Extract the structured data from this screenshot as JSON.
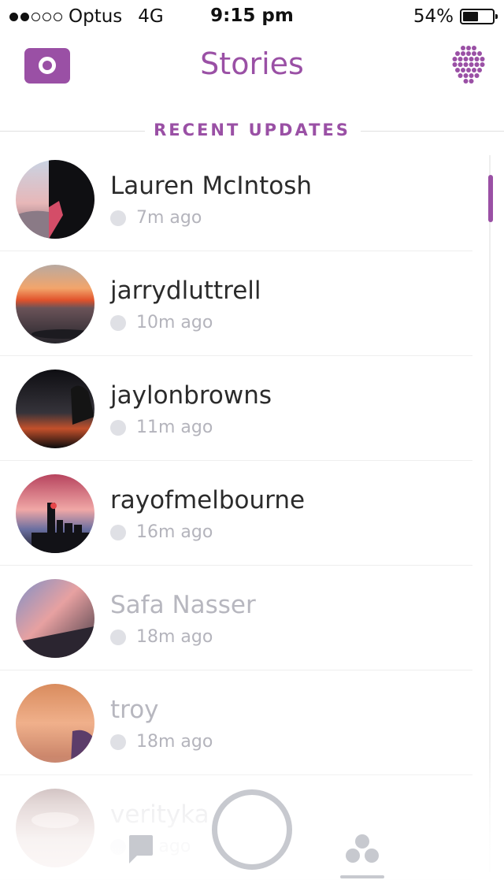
{
  "status_bar": {
    "signal_bars": 2,
    "signal_total": 5,
    "carrier": "Optus",
    "network": "4G",
    "time": "9:15 pm",
    "battery_percent_text": "54%",
    "battery_level": 0.54
  },
  "header": {
    "title": "Stories",
    "camera_icon": "camera-icon",
    "discover_icon": "discover-icon"
  },
  "section": {
    "label": "RECENT UPDATES"
  },
  "stories": [
    {
      "name": "Lauren McIntosh",
      "time": "7m ago",
      "viewed": false,
      "avatar": "sunset-beach"
    },
    {
      "name": "jarrydluttrell",
      "time": "10m ago",
      "viewed": false,
      "avatar": "sunset-sea"
    },
    {
      "name": "jaylonbrowns",
      "time": "11m ago",
      "viewed": false,
      "avatar": "night-clock"
    },
    {
      "name": "rayofmelbourne",
      "time": "16m ago",
      "viewed": false,
      "avatar": "city-sunset"
    },
    {
      "name": "Safa Nasser",
      "time": "18m ago",
      "viewed": true,
      "avatar": "pink-sky"
    },
    {
      "name": "troy",
      "time": "18m ago",
      "viewed": true,
      "avatar": "orange-sky"
    },
    {
      "name": "verityka",
      "time": "m ago",
      "viewed": true,
      "avatar": "glass"
    }
  ],
  "bottom_bar": {
    "chat_icon": "chat-icon",
    "capture_icon": "capture-button-icon",
    "stories_icon": "stories-icon"
  },
  "colors": {
    "accent": "#9a50a5",
    "text": "#2b2b2b",
    "muted": "#b4b4bc",
    "faded_name": "#b7b7bf"
  }
}
